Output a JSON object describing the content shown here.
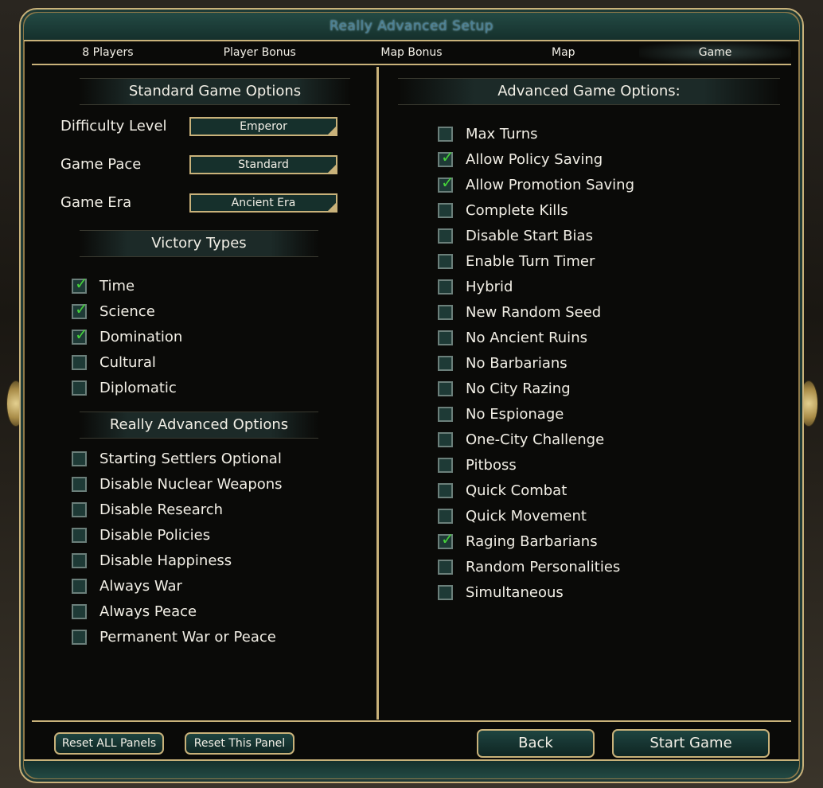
{
  "window": {
    "title": "Really Advanced Setup"
  },
  "tabs": [
    {
      "label": "8  Players",
      "active": false
    },
    {
      "label": "Player Bonus",
      "active": false
    },
    {
      "label": "Map Bonus",
      "active": false
    },
    {
      "label": "Map",
      "active": false
    },
    {
      "label": "Game",
      "active": true
    }
  ],
  "standard": {
    "header": "Standard Game Options",
    "rows": [
      {
        "label": "Difficulty Level",
        "value": "Emperor"
      },
      {
        "label": "Game Pace",
        "value": "Standard"
      },
      {
        "label": "Game Era",
        "value": "Ancient Era"
      }
    ]
  },
  "victory": {
    "header": "Victory Types",
    "items": [
      {
        "label": "Time",
        "checked": true
      },
      {
        "label": "Science",
        "checked": true
      },
      {
        "label": "Domination",
        "checked": true
      },
      {
        "label": "Cultural",
        "checked": false
      },
      {
        "label": "Diplomatic",
        "checked": false
      }
    ]
  },
  "really_advanced": {
    "header": "Really Advanced Options",
    "items": [
      {
        "label": "Starting Settlers Optional",
        "checked": false
      },
      {
        "label": "Disable Nuclear Weapons",
        "checked": false
      },
      {
        "label": "Disable Research",
        "checked": false
      },
      {
        "label": "Disable Policies",
        "checked": false
      },
      {
        "label": "Disable Happiness",
        "checked": false
      },
      {
        "label": "Always War",
        "checked": false
      },
      {
        "label": "Always Peace",
        "checked": false
      },
      {
        "label": "Permanent War or Peace",
        "checked": false
      }
    ]
  },
  "advanced": {
    "header": "Advanced Game Options:",
    "items": [
      {
        "label": "Max Turns",
        "checked": false
      },
      {
        "label": "Allow Policy Saving",
        "checked": true
      },
      {
        "label": "Allow Promotion Saving",
        "checked": true
      },
      {
        "label": "Complete Kills",
        "checked": false
      },
      {
        "label": "Disable Start Bias",
        "checked": false
      },
      {
        "label": "Enable Turn Timer",
        "checked": false
      },
      {
        "label": "Hybrid",
        "checked": false
      },
      {
        "label": "New Random Seed",
        "checked": false
      },
      {
        "label": "No Ancient Ruins",
        "checked": false
      },
      {
        "label": "No Barbarians",
        "checked": false
      },
      {
        "label": "No City Razing",
        "checked": false
      },
      {
        "label": "No Espionage",
        "checked": false
      },
      {
        "label": "One-City Challenge",
        "checked": false
      },
      {
        "label": "Pitboss",
        "checked": false
      },
      {
        "label": "Quick Combat",
        "checked": false
      },
      {
        "label": "Quick Movement",
        "checked": false
      },
      {
        "label": "Raging Barbarians",
        "checked": true
      },
      {
        "label": "Random Personalities",
        "checked": false
      },
      {
        "label": "Simultaneous",
        "checked": false
      }
    ]
  },
  "buttons": {
    "reset_all": "Reset ALL Panels",
    "reset_panel": "Reset This Panel",
    "back": "Back",
    "start": "Start Game"
  },
  "colors": {
    "gold_border": "#c9b27a",
    "teal_panel": "#1e3a36",
    "check_green": "#45d13a"
  }
}
